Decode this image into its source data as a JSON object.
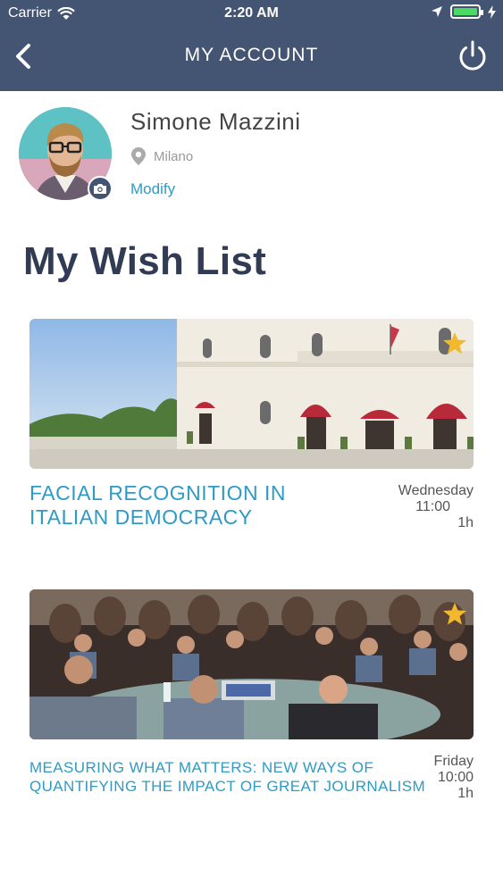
{
  "status_bar": {
    "carrier": "Carrier",
    "time": "2:20 AM"
  },
  "nav": {
    "title": "MY ACCOUNT"
  },
  "profile": {
    "name": "Simone Mazzini",
    "location": "Milano",
    "modify_label": "Modify"
  },
  "wishlist": {
    "title": "My Wish List",
    "items": [
      {
        "title_line1": "FACIAL RECOGNITION IN",
        "title_line2": "ITALIAN DEMOCRACY",
        "day": "Wednesday",
        "time": "11:00",
        "duration": "1h",
        "favorited": true
      },
      {
        "title_line1": "MEASURING WHAT MATTERS: NEW WAYS OF",
        "title_line2": "QUANTIFYING THE IMPACT OF GREAT JOURNALISM",
        "day": "Friday",
        "time": "10:00",
        "duration": "1h",
        "favorited": true
      }
    ]
  },
  "colors": {
    "header_bg": "#445473",
    "accent": "#2e9bc6",
    "heading": "#313b53",
    "star": "#f2b92f"
  },
  "icons": [
    "wifi-icon",
    "location-arrow-icon",
    "battery-icon",
    "charging-icon",
    "back-icon",
    "power-icon",
    "camera-icon",
    "location-pin-icon",
    "star-icon"
  ]
}
